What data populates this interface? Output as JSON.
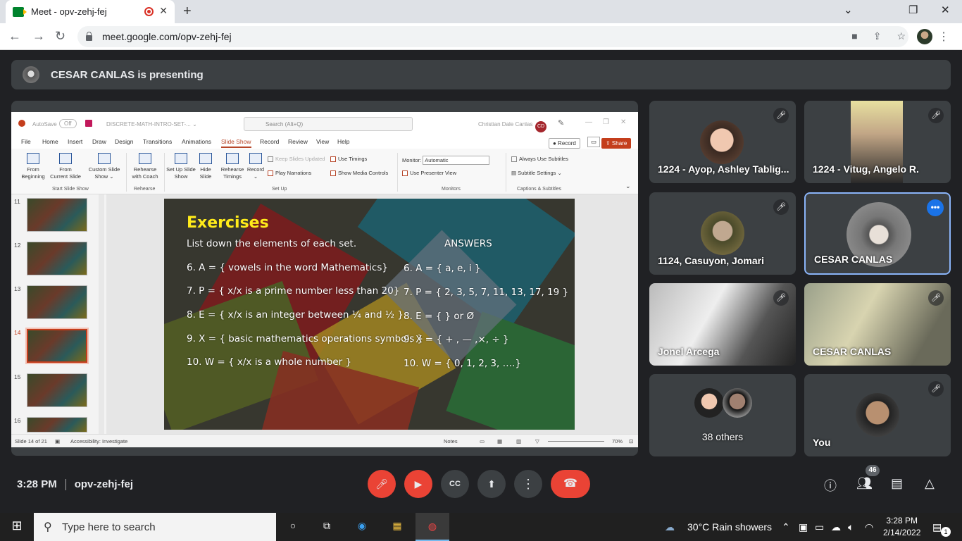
{
  "browser": {
    "tab_title": "Meet - opv-zehj-fej",
    "url": "meet.google.com/opv-zehj-fej",
    "new_tab_glyph": "+",
    "close_glyph": "✕",
    "window_controls": {
      "minimize": "⌄",
      "restore": "❐",
      "close": "✕"
    }
  },
  "presenting_bar": {
    "text": "CESAR CANLAS is presenting"
  },
  "ppt": {
    "autosave": "AutoSave",
    "autosave_state": "Off",
    "doc_title": "DISCRETE-MATH-INTRO-SET-... ⌄",
    "search_placeholder": "Search (Alt+Q)",
    "user_name": "Christian Dale Canlas",
    "user_initials": "CD",
    "menu": [
      "File",
      "Home",
      "Insert",
      "Draw",
      "Design",
      "Transitions",
      "Animations",
      "Slide Show",
      "Record",
      "Review",
      "View",
      "Help"
    ],
    "record_btn": "● Record",
    "share_btn": "⇪ Share",
    "ribbon": {
      "from_beginning": "From Beginning",
      "from_current": "From Current Slide",
      "custom_show": "Custom Slide Show ⌄",
      "rehearse_coach": "Rehearse with Coach",
      "setup_show": "Set Up Slide Show",
      "hide_slide": "Hide Slide",
      "rehearse_timings": "Rehearse Timings",
      "record": "Record ⌄",
      "keep_updated": "Keep Slides Updated",
      "play_narrations": "Play Narrations",
      "use_timings": "Use Timings",
      "show_media": "Show Media Controls",
      "monitor_label": "Monitor:",
      "monitor_value": "Automatic",
      "presenter_view": "Use Presenter View",
      "always_subtitles": "Always Use Subtitles",
      "subtitle_settings": "Subtitle Settings ⌄",
      "groups": [
        "Start Slide Show",
        "Rehearse",
        "Set Up",
        "Monitors",
        "Captions & Subtitles"
      ]
    },
    "thumb_numbers": [
      "11",
      "12",
      "13",
      "14",
      "15",
      "16"
    ],
    "status": {
      "slide_count": "Slide 14 of 21",
      "accessibility": "Accessibility: Investigate",
      "notes": "Notes",
      "zoom": "70%"
    }
  },
  "slide": {
    "title": "Exercises",
    "instruction": "List down the elements of each set.",
    "answers_header": "ANSWERS",
    "questions": [
      "6. A = { vowels in the word Mathematics}",
      "7. P = { x/x is a prime number less than 20}",
      "8. E = { x/x is an integer between ¼ and ½ }",
      "9. X = { basic mathematics operations symbols }",
      "10. W = { x/x is a whole number }"
    ],
    "answers": [
      "6. A = { a, e, i }",
      "7. P = { 2, 3, 5, 7, 11, 13, 17, 19 }",
      "8. E = {  } or Ø",
      "9. X = { + , — ,×,  ÷ }",
      "10. W = { 0, 1, 2, 3, ….}"
    ]
  },
  "participants": [
    {
      "name": "1224 - Ayop, Ashley Tablig...",
      "muted": true
    },
    {
      "name": "1224 - Vitug, Angelo R.",
      "muted": true
    },
    {
      "name": "1124, Casuyon, Jomari",
      "muted": true
    },
    {
      "name": "CESAR CANLAS",
      "muted": false
    },
    {
      "name": "Jonel Arcega",
      "muted": true
    },
    {
      "name": "CESAR CANLAS",
      "muted": true
    },
    {
      "name": "38 others",
      "muted": false
    },
    {
      "name": "You",
      "muted": true
    }
  ],
  "bottom": {
    "time": "3:28 PM",
    "meeting_code": "opv-zehj-fej",
    "people_count": "46",
    "cc_glyph": "CC"
  },
  "taskbar": {
    "search_placeholder": "Type here to search",
    "weather": "30°C  Rain showers",
    "time": "3:28 PM",
    "date": "2/14/2022",
    "notification_count": "1"
  },
  "colors": {
    "meet_bg": "#202124",
    "tile_bg": "#3c4043",
    "red": "#ea4335",
    "blue": "#1a73e8",
    "slide_title": "#ffeb1a",
    "ppt_accent": "#b7472a"
  }
}
